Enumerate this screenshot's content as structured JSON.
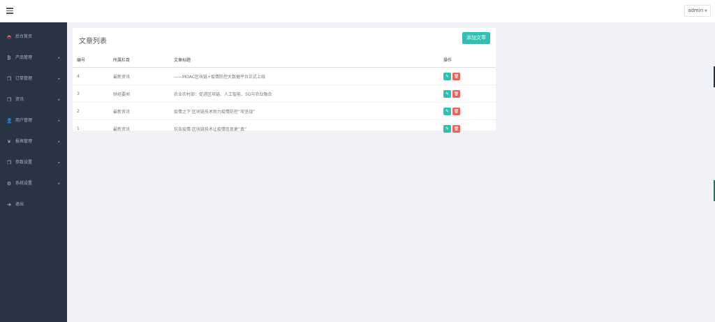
{
  "topbar": {
    "user": "admin",
    "caret": "▼"
  },
  "sidebar": {
    "items": [
      {
        "label": "后台首页",
        "icon": "dashboard-icon",
        "glyph": "◓",
        "arrow": ""
      },
      {
        "label": "产品管理",
        "icon": "bitcoin-icon",
        "glyph": "₿",
        "arrow": "▸"
      },
      {
        "label": "订单管理",
        "icon": "copy-icon",
        "glyph": "❐",
        "arrow": "▸"
      },
      {
        "label": "资讯",
        "icon": "copy-icon",
        "glyph": "❐",
        "arrow": "▸"
      },
      {
        "label": "用户管理",
        "icon": "user-icon",
        "glyph": "👤",
        "arrow": "▸"
      },
      {
        "label": "报表管理",
        "icon": "yen-icon",
        "glyph": "¥",
        "arrow": "▸"
      },
      {
        "label": "参数设置",
        "icon": "copy-icon",
        "glyph": "❐",
        "arrow": "▸"
      },
      {
        "label": "系统设置",
        "icon": "cogs-icon",
        "glyph": "⚙",
        "arrow": "▸"
      },
      {
        "label": "退出",
        "icon": "sign-out-icon",
        "glyph": "➜",
        "arrow": ""
      }
    ]
  },
  "panel": {
    "title": "文章列表",
    "add_button": "添加文章",
    "columns": [
      "编号",
      "所属栏目",
      "文章标题",
      "操作"
    ],
    "rows": [
      {
        "id": "4",
        "category": "最新资讯",
        "title": "——MOAC区块链+疫情防控大数据平台正式上线"
      },
      {
        "id": "3",
        "category": "财经要闻",
        "title": "农业农村部：促进区块链、人工智能、5G与农业融合"
      },
      {
        "id": "2",
        "category": "最新资讯",
        "title": "疫情之下 区块链技术助力疫情防控“攻坚战”"
      },
      {
        "id": "1",
        "category": "最新资讯",
        "title": "抗击疫情 区块链技术让疫情信息更“真”"
      }
    ],
    "edit_glyph": "✎",
    "delete_glyph": "🗑"
  }
}
